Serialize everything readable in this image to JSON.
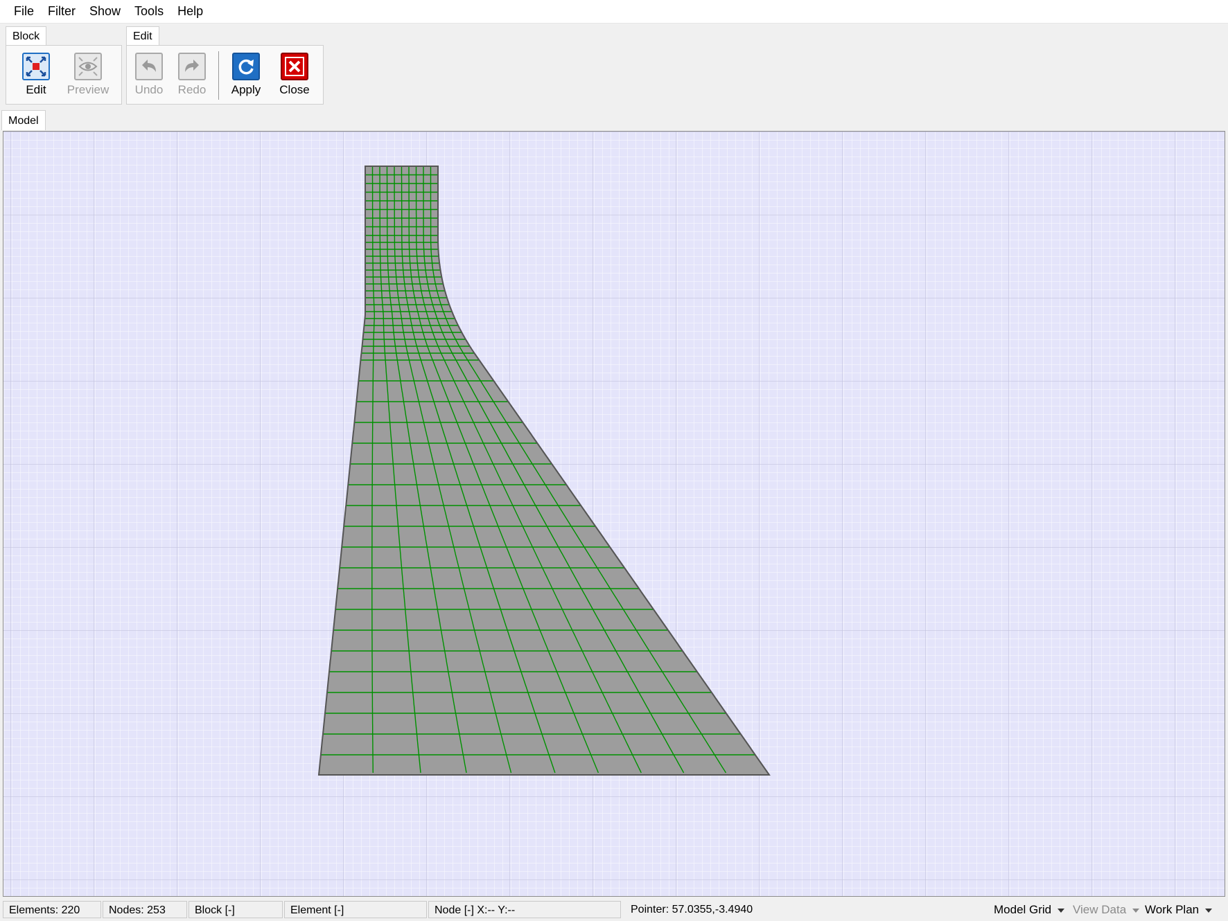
{
  "menu": [
    "File",
    "Filter",
    "Show",
    "Tools",
    "Help"
  ],
  "ribbon": {
    "tabs": {
      "block": "Block",
      "edit": "Edit"
    },
    "buttons": {
      "edit": "Edit",
      "preview": "Preview",
      "undo": "Undo",
      "redo": "Redo",
      "apply": "Apply",
      "close": "Close"
    }
  },
  "model_tab": "Model",
  "status": {
    "elements": "Elements: 220",
    "nodes": "Nodes: 253",
    "block": "Block [-]",
    "element": "Element [-]",
    "node": "Node [-]  X:-- Y:--",
    "pointer": "Pointer: 57.0355,-3.4940",
    "model_grid": "Model Grid",
    "view_data": "View Data",
    "work_plan": "Work Plan"
  },
  "colors": {
    "viewport_bg": "#e4e4fa",
    "mesh_fill": "#9d9d9d",
    "mesh_lines": "#009100",
    "outline": "#555555",
    "apply_icon": "#1f6fc4",
    "close_icon": "#d40000"
  },
  "icons": {
    "edit": "edit-block-icon",
    "preview": "eye-icon",
    "undo": "undo-icon",
    "redo": "redo-icon",
    "apply": "refresh-icon",
    "close": "close-icon"
  }
}
